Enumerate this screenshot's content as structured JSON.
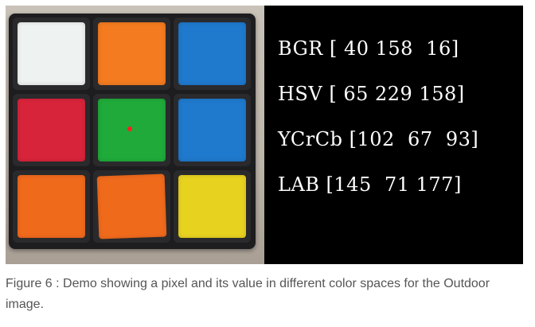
{
  "figure": {
    "photo": {
      "grid": [
        [
          "#eef2f0",
          "#f47b1f",
          "#1f79cc"
        ],
        [
          "#d8243a",
          "#1faa3a",
          "#1f79cc"
        ],
        [
          "#f06a1c",
          "#f06a1c",
          "#e8d220"
        ]
      ],
      "probe_color": "#ff2020"
    },
    "readout": {
      "lines": [
        "BGR [ 40 158  16]",
        "HSV [ 65 229 158]",
        "YCrCb [102  67  93]",
        "LAB [145  71 177]"
      ]
    },
    "caption": "Figure 6 : Demo showing a pixel and its value in different color spaces for the Outdoor image."
  }
}
